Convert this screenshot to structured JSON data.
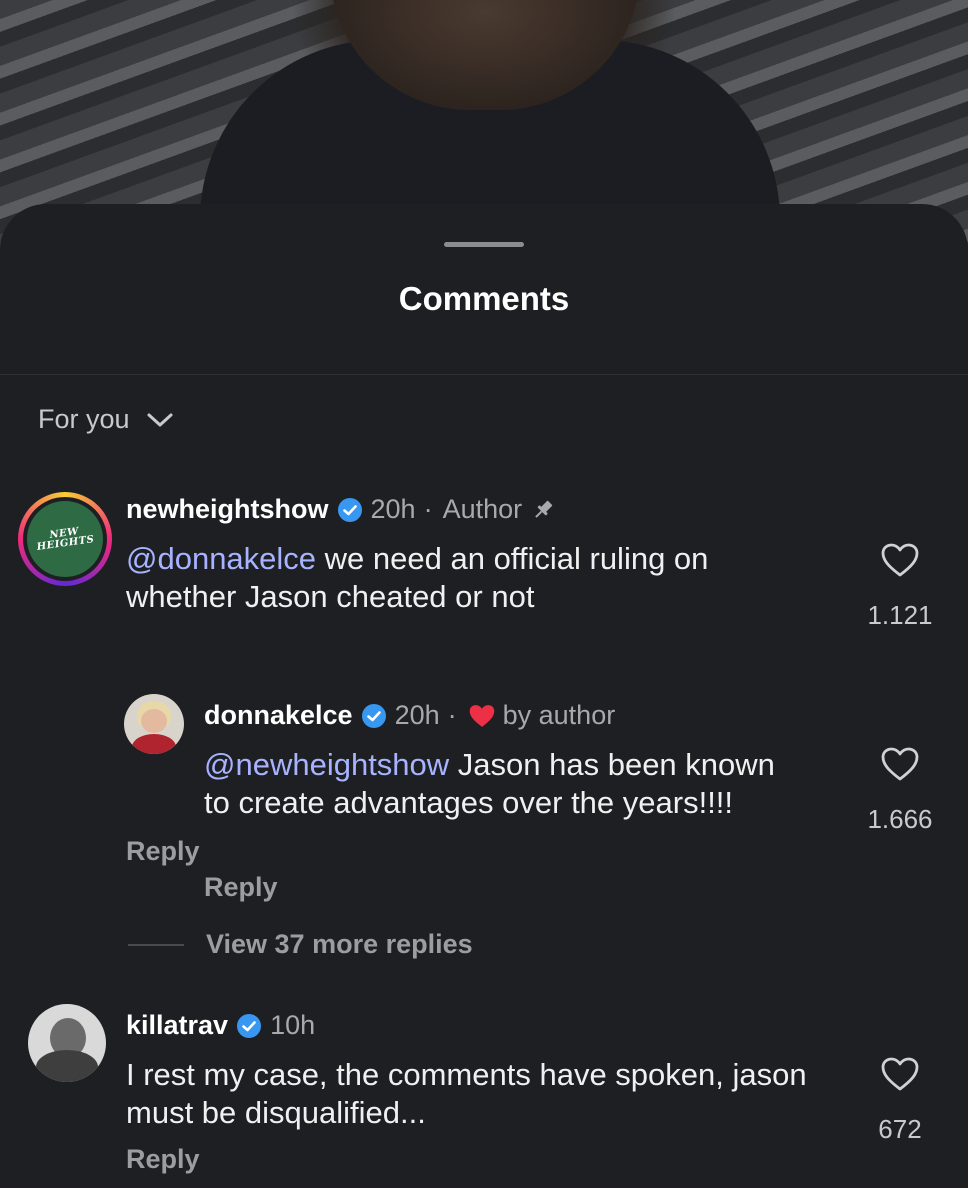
{
  "sheet": {
    "title": "Comments"
  },
  "filter": {
    "label": "For you",
    "icon": "chevron-down-icon"
  },
  "comments": [
    {
      "username": "newheightshow",
      "verified": true,
      "time": "20h",
      "separator": "·",
      "tag": "Author",
      "pinned": true,
      "avatar_text": "NEW HEIGHTS",
      "mention": "@donnakelce",
      "text": " we need an official ruling on whether Jason cheated or not",
      "likes": "1.121",
      "reply_label": "Reply"
    },
    {
      "username": "donnakelce",
      "verified": true,
      "time": "20h",
      "separator": "·",
      "liked_by": "by author",
      "mention": "@newheightshow",
      "text": " Jason has been known to create advantages over the years!!!!",
      "likes": "1.666",
      "reply_label": "Reply"
    },
    {
      "username": "killatrav",
      "verified": true,
      "time": "10h",
      "text": "I rest my case, the comments have spoken, jason must be disqualified...",
      "likes": "672",
      "reply_label": "Reply"
    }
  ],
  "view_more": {
    "label": "View 37 more replies"
  },
  "colors": {
    "background": "#1e1f23",
    "mention": "#a7b3ff",
    "verified": "#3897f0",
    "heart_red": "#ed3045"
  }
}
